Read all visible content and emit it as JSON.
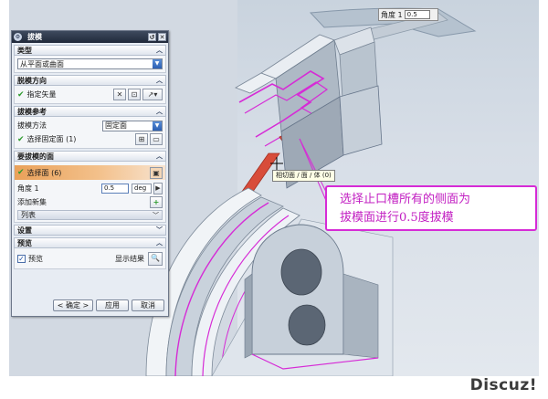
{
  "viewport": {
    "angle_label": "角度 1",
    "angle_value": "0.5",
    "tooltip": "相切面 / 面 / 体 (0)",
    "callout_lines": [
      "选择止口槽所有的侧面为",
      "拔模面进行0.5度拔模"
    ],
    "watermark": "Discuz!"
  },
  "dialog": {
    "title": "拔模",
    "type_section": {
      "label": "类型",
      "selected": "从平面或曲面"
    },
    "direction_section": {
      "label": "脱模方向",
      "specify_vector": "指定矢量"
    },
    "reference_section": {
      "label": "拔模参考",
      "method_label": "拔模方法",
      "method_value": "固定面",
      "select_fixed_face": "选择固定面 (1)"
    },
    "faces_section": {
      "label": "要拔模的面",
      "select_face": "选择面 (6)",
      "angle_label": "角度 1",
      "angle_value": "0.5",
      "angle_unit": "deg",
      "add_new_set": "添加新集",
      "list_label": "列表"
    },
    "settings_section": {
      "label": "设置"
    },
    "preview_section": {
      "label": "预览",
      "preview_checkbox": "预览",
      "show_result": "显示结果"
    },
    "buttons": {
      "ok": "< 确定 >",
      "apply": "应用",
      "cancel": "取消"
    }
  },
  "colors": {
    "accent_magenta": "#d62bd6",
    "highlight_orange": "#e9a15a",
    "titlebar": "#20293a"
  }
}
